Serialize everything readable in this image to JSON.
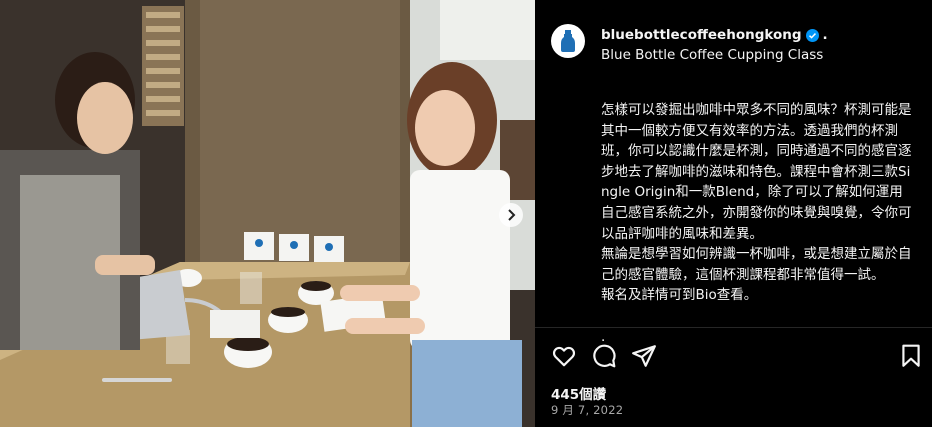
{
  "post": {
    "username": "bluebottlecoffeehongkong",
    "username_suffix": ".",
    "title": "Blue Bottle Coffee Cupping Class",
    "caption": "怎樣可以發掘出咖啡中眾多不同的風味？杯測可能是其中一個較方便又有效率的方法。透過我們的杯測班，你可以認識什麼是杯測，同時通過不同的感官逐步地去了解咖啡的滋味和特色。課程中會杯測三款Single Origin和一款Blend，除了可以了解如何運用自己感官系統之外，亦開發你的味覺與嗅覺，令你可以品評咖啡的風味和差異。\n無論是想學習如何辨識一杯咖啡，或是想建立屬於自己的感官體驗，這個杯測課程都非常值得一試。\n報名及詳情可到Bio查看。\n\n.",
    "likes": "445個讚",
    "date": "9 月 7, 2022"
  },
  "icons": {
    "avatar": "blue-bottle-logo-icon",
    "verified": "verified-badge-icon",
    "like": "heart-icon",
    "comment": "comment-bubble-icon",
    "share": "paper-plane-icon",
    "save": "bookmark-icon",
    "next": "chevron-right-icon"
  },
  "colors": {
    "background": "#000000",
    "text": "#f5f5f5",
    "secondary_text": "#a8a8a8",
    "verified": "#0095f6",
    "brand_blue": "#1f6fb5"
  }
}
